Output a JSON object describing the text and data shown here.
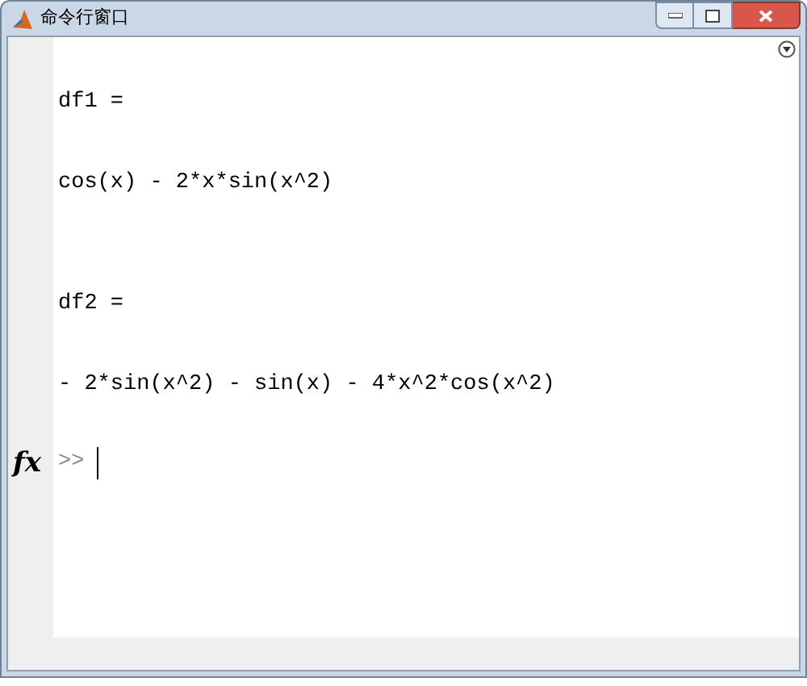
{
  "window": {
    "title": "命令行窗口"
  },
  "output": [
    {
      "kind": "label",
      "text": "df1 ="
    },
    {
      "kind": "value",
      "text": "cos(x) - 2*x*sin(x^2)"
    },
    {
      "kind": "label",
      "text": "df2 ="
    },
    {
      "kind": "value",
      "text": "- 2*sin(x^2) - sin(x) - 4*x^2*cos(x^2)"
    }
  ],
  "prompt": {
    "fx": "fx",
    "symbol": ">>"
  }
}
